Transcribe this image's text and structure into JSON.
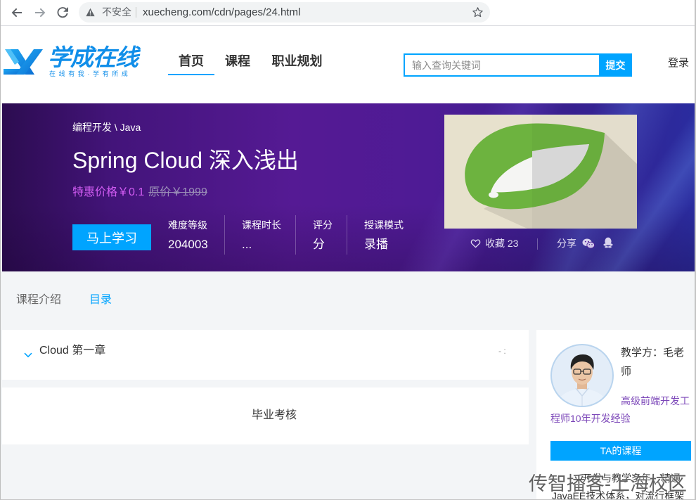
{
  "browser": {
    "security_label": "不安全",
    "url": "xuecheng.com/cdn/pages/24.html"
  },
  "header": {
    "logo_text": "学成在线",
    "logo_slogan": "在线有我·学有所成",
    "nav": [
      {
        "label": "首页",
        "active": true
      },
      {
        "label": "课程",
        "active": false
      },
      {
        "label": "职业规划",
        "active": false
      }
    ],
    "search_placeholder": "输入查询关键词",
    "search_button": "提交",
    "login": "登录"
  },
  "course": {
    "breadcrumb": "编程开发 \\ Java",
    "title": "Spring Cloud 深入浅出",
    "promo_price": "特惠价格￥0.1",
    "original_price": "原价￥1999",
    "study_button": "马上学习",
    "stats": [
      {
        "label": "难度等级",
        "value": "204003"
      },
      {
        "label": "课程时长",
        "value": "..."
      },
      {
        "label": "评分",
        "value": "分"
      },
      {
        "label": "授课模式",
        "value": "录播"
      }
    ],
    "favorite_label": "收藏",
    "favorite_count": "23",
    "share_label": "分享"
  },
  "tabs": [
    {
      "label": "课程介绍",
      "active": false
    },
    {
      "label": "目录",
      "active": true
    }
  ],
  "chapters": [
    {
      "title": "Cloud 第一章",
      "meta": "- :"
    }
  ],
  "final_exam": "毕业考核",
  "teacher": {
    "name_line": "教学方：毛老师",
    "intro": "高级前端开发工程师10年开发经验",
    "courses_button": "TA的课程",
    "bio_lines": [
      "开发与教学多年，精通",
      "JavaEE技术体系，对流行框架"
    ]
  },
  "watermark": "传智播客-上海校区",
  "colors": {
    "accent": "#00a4ff",
    "logo_blue": "#108ee9",
    "banner_purple": "#551a94",
    "promo_price": "#d25cf3",
    "teacher_intro": "#7b46b8",
    "spring_green": "#6db33f"
  },
  "icons": {
    "back": "back-arrow-icon",
    "forward": "forward-arrow-icon",
    "reload": "reload-icon",
    "security": "warning-icon",
    "bookmark": "star-icon",
    "favorite": "heart-icon",
    "share_wechat": "wechat-icon",
    "share_qq": "qq-icon",
    "chapter_toggle": "chevron-down-icon"
  }
}
